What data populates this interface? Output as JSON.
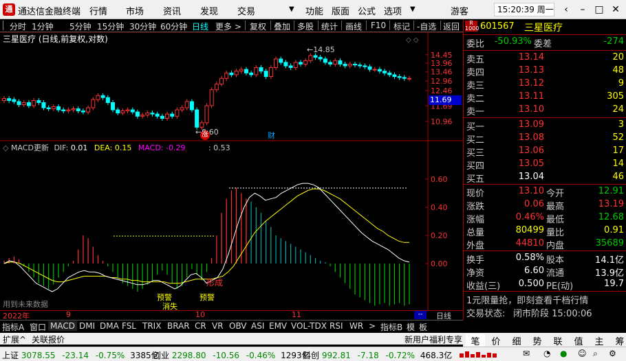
{
  "titlebar": {
    "app_name": "通达信金融终端",
    "menus": [
      "行情",
      "市场",
      "资讯",
      "发现",
      "交易"
    ],
    "right_menus": [
      "功能",
      "版面",
      "公式",
      "选项"
    ],
    "user": "游客",
    "clock": "15:20:39 周一"
  },
  "toolbar": {
    "periods": [
      "分时",
      "1分钟",
      "5分钟",
      "15分钟",
      "30分钟",
      "60分钟",
      "日线",
      "更多 >"
    ],
    "selected": "日线",
    "tools": [
      "复权",
      "叠加",
      "多股",
      "统计",
      "画线",
      "F10",
      "标记",
      "-自选",
      "返回"
    ]
  },
  "main_chart": {
    "title": "三星医疗 (日线,前复权,对数)",
    "high_label": "14.85",
    "low_label": "9.60",
    "price_ticks": [
      "14.45",
      "13.96",
      "13.46",
      "12.96",
      "12.46",
      "11.69",
      "10.96"
    ],
    "current_price_tag": "11.69",
    "marker_up": "涨",
    "marker_fin": "财"
  },
  "macd": {
    "name": "MACD更新",
    "dif_label": "DIF:",
    "dif": "0.01",
    "dea_label": "DEA:",
    "dea": "0.15",
    "macd_label": "MACD:",
    "macd": "-0.29",
    "extra": ": 0.53",
    "ticks": [
      "0.60",
      "0.40",
      "0.20",
      "0.00"
    ],
    "annotations": [
      "预警",
      "消失",
      "预警",
      "形成",
      "预警"
    ],
    "future_note": "用到未来数据"
  },
  "datebar": {
    "labels": [
      "2022年",
      "9",
      "10",
      "11"
    ],
    "right_label": "日线"
  },
  "tabs": [
    "指标A",
    "窗口",
    "MACD",
    "DMI",
    "DMA",
    "FSL",
    "TRIX",
    "BRAR",
    "CR",
    "VR",
    "OBV",
    "ASI",
    "EMV",
    "VOL-TDX",
    "RSI",
    "WR",
    ">",
    "指标B",
    "模",
    "板"
  ],
  "status1": {
    "left": [
      "扩展^",
      "关联报价"
    ],
    "right": "新用户福利专享"
  },
  "quote": {
    "code": "601567",
    "name": "三星医疗",
    "wb_label": "委比",
    "wb": "-50.93%",
    "wc_label": "委差",
    "wc": "-274",
    "asks": [
      {
        "label": "卖五",
        "price": "13.14",
        "vol": "20"
      },
      {
        "label": "卖四",
        "price": "13.13",
        "vol": "48"
      },
      {
        "label": "卖三",
        "price": "13.12",
        "vol": "9"
      },
      {
        "label": "卖二",
        "price": "13.11",
        "vol": "305"
      },
      {
        "label": "卖一",
        "price": "13.10",
        "vol": "24"
      }
    ],
    "bids": [
      {
        "label": "买一",
        "price": "13.09",
        "vol": "3"
      },
      {
        "label": "买二",
        "price": "13.08",
        "vol": "52"
      },
      {
        "label": "买三",
        "price": "13.06",
        "vol": "17"
      },
      {
        "label": "买四",
        "price": "13.05",
        "vol": "14"
      },
      {
        "label": "买五",
        "price": "13.04",
        "vol": "46"
      }
    ],
    "stats": [
      {
        "l1": "现价",
        "v1": "13.10",
        "c1": "red",
        "l2": "今开",
        "v2": "12.91",
        "c2": "green"
      },
      {
        "l1": "涨跌",
        "v1": "0.06",
        "c1": "red",
        "l2": "最高",
        "v2": "13.19",
        "c2": "red"
      },
      {
        "l1": "涨幅",
        "v1": "0.46%",
        "c1": "red",
        "l2": "最低",
        "v2": "12.68",
        "c2": "green"
      },
      {
        "l1": "总量",
        "v1": "80499",
        "c1": "yellow",
        "l2": "量比",
        "v2": "0.91",
        "c2": "yellow"
      },
      {
        "l1": "外盘",
        "v1": "44810",
        "c1": "red",
        "l2": "内盘",
        "v2": "35689",
        "c2": "green"
      }
    ],
    "stats2": [
      {
        "l1": "换手",
        "v1": "0.58%",
        "l2": "股本",
        "v2": "14.1亿"
      },
      {
        "l1": "净资",
        "v1": "6.60",
        "l2": "流通",
        "v2": "13.9亿"
      },
      {
        "l1": "收益(三)",
        "v1": "0.500",
        "l2": "PE(动)",
        "v2": "19.7"
      }
    ],
    "promo": "1元限量抢，即刻查看千档行情",
    "trade_status_label": "交易状态:",
    "trade_status": "闭市阶段 15:00:06",
    "rp_tabs": [
      "笔",
      "价",
      "细",
      "势",
      "联",
      "值",
      "主",
      "筹"
    ]
  },
  "status2": [
    {
      "name": "上证",
      "v": "3078.55",
      "chg": "-23.14",
      "pct": "-0.75%",
      "amt": "3385亿"
    },
    {
      "name": "创业",
      "v": "2298.80",
      "chg": "-10.56",
      "pct": "-0.46%",
      "amt": "1293亿"
    },
    {
      "name": "科创",
      "v": "992.81",
      "chg": "-7.18",
      "pct": "-0.72%",
      "amt": "468.3亿"
    }
  ],
  "colors": {
    "up": "#ff3333",
    "down": "#00ffff",
    "macd_neg": "#00c000",
    "dif": "#ffffff",
    "dea": "#ffff00"
  }
}
